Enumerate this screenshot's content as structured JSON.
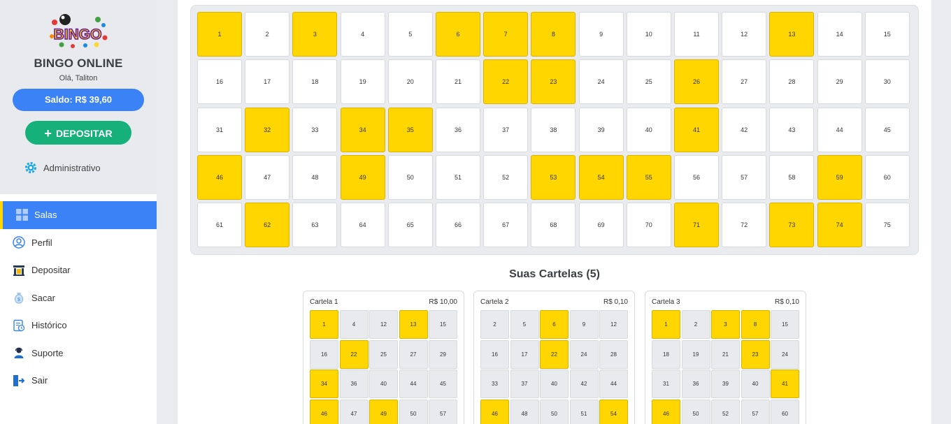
{
  "sidebar": {
    "app_name": "BINGO ONLINE",
    "logo_text": "BINGO",
    "greeting": "Olá, Taliton",
    "balance": "Saldo: R$ 39,60",
    "deposit_button": "DEPOSITAR",
    "admin_label": "Administrativo",
    "nav": [
      {
        "label": "Salas",
        "icon": "grid-icon",
        "active": true
      },
      {
        "label": "Perfil",
        "icon": "user-icon",
        "active": false
      },
      {
        "label": "Depositar",
        "icon": "bank-icon",
        "active": false
      },
      {
        "label": "Sacar",
        "icon": "money-bag-icon",
        "active": false
      },
      {
        "label": "Histórico",
        "icon": "history-icon",
        "active": false
      },
      {
        "label": "Suporte",
        "icon": "support-icon",
        "active": false
      },
      {
        "label": "Sair",
        "icon": "logout-icon",
        "active": false
      }
    ]
  },
  "board": {
    "numbers_total": 75,
    "drawn": [
      1,
      3,
      6,
      7,
      8,
      13,
      22,
      23,
      26,
      32,
      34,
      35,
      41,
      46,
      49,
      53,
      54,
      55,
      59,
      62,
      71,
      73,
      74
    ]
  },
  "cards_section": {
    "title": "Suas Cartelas (5)",
    "cards": [
      {
        "name": "Cartela 1",
        "price": "R$ 10,00",
        "rows": [
          [
            1,
            4,
            12,
            13,
            15
          ],
          [
            16,
            22,
            25,
            27,
            29
          ],
          [
            34,
            36,
            40,
            44,
            45
          ],
          [
            46,
            47,
            49,
            50,
            57
          ]
        ]
      },
      {
        "name": "Cartela 2",
        "price": "R$ 0,10",
        "rows": [
          [
            2,
            5,
            6,
            9,
            12
          ],
          [
            16,
            17,
            22,
            24,
            28
          ],
          [
            33,
            37,
            40,
            42,
            44
          ],
          [
            46,
            48,
            50,
            51,
            54
          ]
        ]
      },
      {
        "name": "Cartela 3",
        "price": "R$ 0,10",
        "rows": [
          [
            1,
            2,
            3,
            8,
            15
          ],
          [
            18,
            19,
            21,
            23,
            24
          ],
          [
            31,
            36,
            39,
            40,
            41
          ],
          [
            46,
            50,
            52,
            57,
            60
          ]
        ]
      }
    ]
  },
  "colors": {
    "accent_blue": "#3b82f6",
    "drawn_yellow": "#ffd600",
    "deposit_green": "#16b07a"
  }
}
